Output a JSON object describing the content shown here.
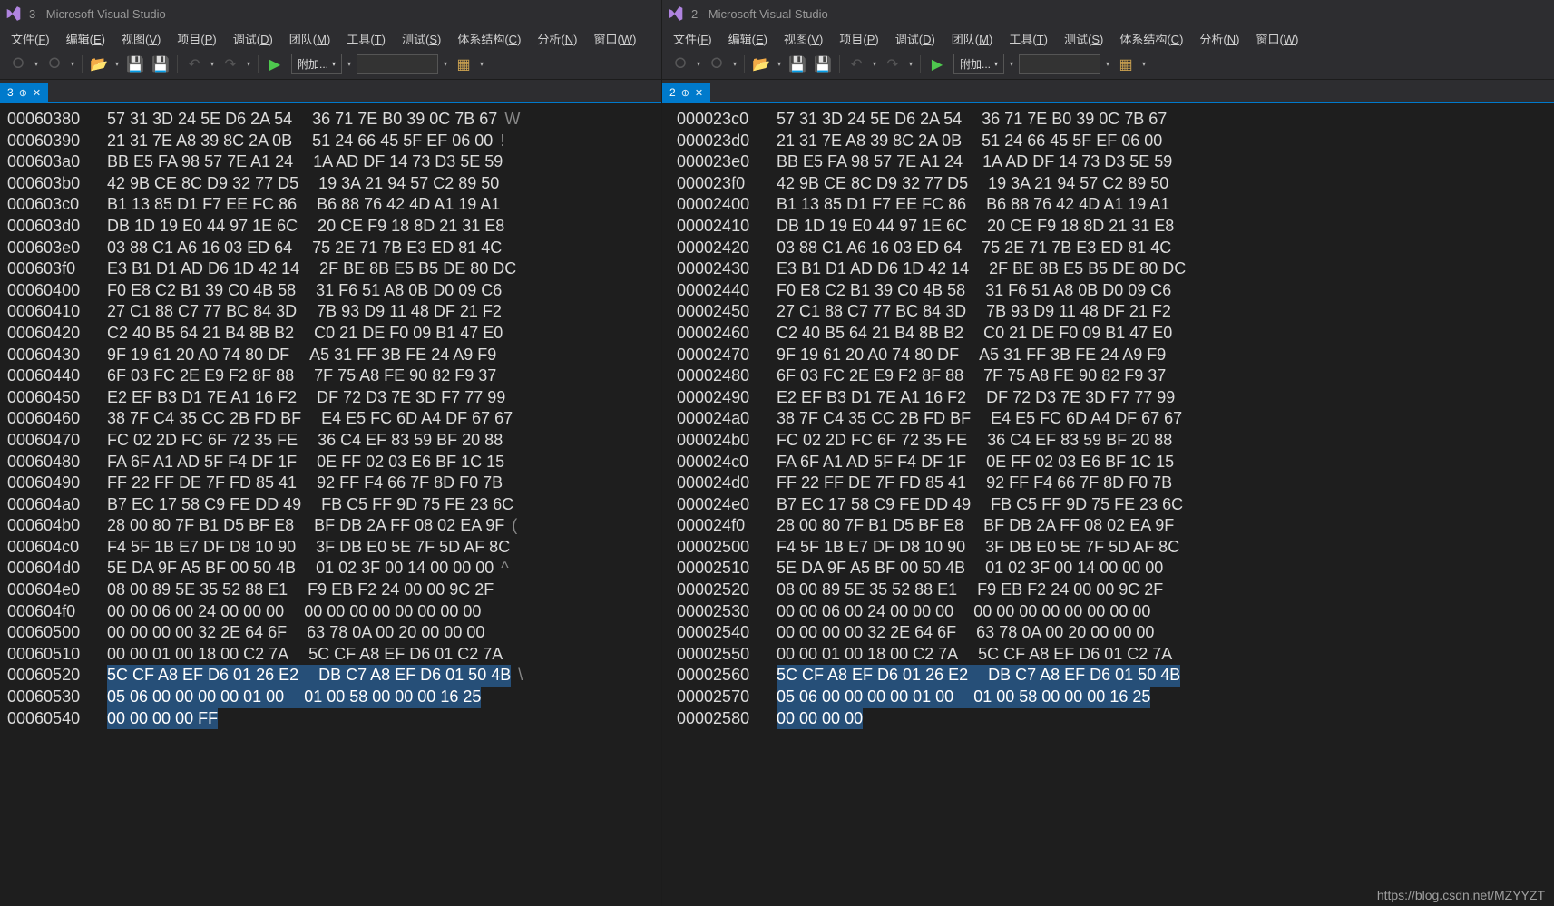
{
  "left": {
    "title": "3 - Microsoft Visual Studio",
    "menu": [
      "文件(F)",
      "编辑(E)",
      "视图(V)",
      "项目(P)",
      "调试(D)",
      "团队(M)",
      "工具(T)",
      "测试(S)",
      "体系结构(C)",
      "分析(N)",
      "窗口(W)"
    ],
    "attach": "附加...",
    "tab": "3",
    "rows": [
      {
        "o": "00060380",
        "a": "57 31 3D 24 5E D6 2A 54",
        "b": "36 71 7E B0 39 0C 7B 67",
        "c": "W"
      },
      {
        "o": "00060390",
        "a": "21 31 7E A8 39 8C 2A 0B",
        "b": "51 24 66 45 5F EF 06 00",
        "c": "!"
      },
      {
        "o": "000603a0",
        "a": "BB E5 FA 98 57 7E A1 24",
        "b": "1A AD DF 14 73 D3 5E 59",
        "c": ""
      },
      {
        "o": "000603b0",
        "a": "42 9B CE 8C D9 32 77 D5",
        "b": "19 3A 21 94 57 C2 89 50",
        "c": ""
      },
      {
        "o": "000603c0",
        "a": "B1 13 85 D1 F7 EE FC 86",
        "b": "B6 88 76 42 4D A1 19 A1",
        "c": ""
      },
      {
        "o": "000603d0",
        "a": "DB 1D 19 E0 44 97 1E 6C",
        "b": "20 CE F9 18 8D 21 31 E8",
        "c": ""
      },
      {
        "o": "000603e0",
        "a": "03 88 C1 A6 16 03 ED 64",
        "b": "75 2E 71 7B E3 ED 81 4C",
        "c": ""
      },
      {
        "o": "000603f0",
        "a": "E3 B1 D1 AD D6 1D 42 14",
        "b": "2F BE 8B E5 B5 DE 80 DC",
        "c": ""
      },
      {
        "o": "00060400",
        "a": "F0 E8 C2 B1 39 C0 4B 58",
        "b": "31 F6 51 A8 0B D0 09 C6",
        "c": ""
      },
      {
        "o": "00060410",
        "a": "27 C1 88 C7 77 BC 84 3D",
        "b": "7B 93 D9 11 48 DF 21 F2",
        "c": ""
      },
      {
        "o": "00060420",
        "a": "C2 40 B5 64 21 B4 8B B2",
        "b": "C0 21 DE F0 09 B1 47 E0",
        "c": ""
      },
      {
        "o": "00060430",
        "a": "9F 19 61 20 A0 74 80 DF",
        "b": "A5 31 FF 3B FE 24 A9 F9",
        "c": ""
      },
      {
        "o": "00060440",
        "a": "6F 03 FC 2E E9 F2 8F 88",
        "b": "7F 75 A8 FE 90 82 F9 37",
        "c": ""
      },
      {
        "o": "00060450",
        "a": "E2 EF B3 D1 7E A1 16 F2",
        "b": "DF 72 D3 7E 3D F7 77 99",
        "c": ""
      },
      {
        "o": "00060460",
        "a": "38 7F C4 35 CC 2B FD BF",
        "b": "E4 E5 FC 6D A4 DF 67 67",
        "c": ""
      },
      {
        "o": "00060470",
        "a": "FC 02 2D FC 6F 72 35 FE",
        "b": "36 C4 EF 83 59 BF 20 88",
        "c": ""
      },
      {
        "o": "00060480",
        "a": "FA 6F A1 AD 5F F4 DF 1F",
        "b": "0E FF 02 03 E6 BF 1C 15",
        "c": ""
      },
      {
        "o": "00060490",
        "a": "FF 22 FF DE 7F FD 85 41",
        "b": "92 FF F4 66 7F 8D F0 7B",
        "c": ""
      },
      {
        "o": "000604a0",
        "a": "B7 EC 17 58 C9 FE DD 49",
        "b": "FB C5 FF 9D 75 FE 23 6C",
        "c": ""
      },
      {
        "o": "000604b0",
        "a": "28 00 80 7F B1 D5 BF E8",
        "b": "BF DB 2A FF 08 02 EA 9F",
        "c": "("
      },
      {
        "o": "000604c0",
        "a": "F4 5F 1B E7 DF D8 10 90",
        "b": "3F DB E0 5E 7F 5D AF 8C",
        "c": ""
      },
      {
        "o": "000604d0",
        "a": "5E DA 9F A5 BF 00 50 4B",
        "b": "01 02 3F 00 14 00 00 00",
        "c": "^"
      },
      {
        "o": "000604e0",
        "a": "08 00 89 5E 35 52 88 E1",
        "b": "F9 EB F2 24 00 00 9C 2F",
        "c": ""
      },
      {
        "o": "000604f0",
        "a": "00 00 06 00 24 00 00 00",
        "b": "00 00 00 00 00 00 00 00",
        "c": ""
      },
      {
        "o": "00060500",
        "a": "00 00 00 00 32 2E 64 6F",
        "b": "63 78 0A 00 20 00 00 00",
        "c": ""
      },
      {
        "o": "00060510",
        "a": "00 00 01 00 18 00 C2 7A",
        "b": "5C CF A8 EF D6 01 C2 7A",
        "c": ""
      }
    ],
    "selected": [
      {
        "o": "00060520",
        "a": "5C CF A8 EF D6 01 26 E2",
        "b": "DB C7 A8 EF D6 01 50 4B",
        "c": "\\"
      },
      {
        "o": "00060530",
        "a": "05 06 00 00 00 00 01 00",
        "b": "01 00 58 00 00 00 16 25",
        "c": ""
      },
      {
        "o": "00060540",
        "a": "00 00 00 00 FF",
        "b": "",
        "c": ""
      }
    ]
  },
  "right": {
    "title": "2 - Microsoft Visual Studio",
    "menu": [
      "文件(F)",
      "编辑(E)",
      "视图(V)",
      "项目(P)",
      "调试(D)",
      "团队(M)",
      "工具(T)",
      "测试(S)",
      "体系结构(C)",
      "分析(N)",
      "窗口(W)"
    ],
    "attach": "附加...",
    "tab": "2",
    "rows": [
      {
        "o": "000023c0",
        "a": "57 31 3D 24 5E D6 2A 54",
        "b": "36 71 7E B0 39 0C 7B 67"
      },
      {
        "o": "000023d0",
        "a": "21 31 7E A8 39 8C 2A 0B",
        "b": "51 24 66 45 5F EF 06 00"
      },
      {
        "o": "000023e0",
        "a": "BB E5 FA 98 57 7E A1 24",
        "b": "1A AD DF 14 73 D3 5E 59"
      },
      {
        "o": "000023f0",
        "a": "42 9B CE 8C D9 32 77 D5",
        "b": "19 3A 21 94 57 C2 89 50"
      },
      {
        "o": "00002400",
        "a": "B1 13 85 D1 F7 EE FC 86",
        "b": "B6 88 76 42 4D A1 19 A1"
      },
      {
        "o": "00002410",
        "a": "DB 1D 19 E0 44 97 1E 6C",
        "b": "20 CE F9 18 8D 21 31 E8"
      },
      {
        "o": "00002420",
        "a": "03 88 C1 A6 16 03 ED 64",
        "b": "75 2E 71 7B E3 ED 81 4C"
      },
      {
        "o": "00002430",
        "a": "E3 B1 D1 AD D6 1D 42 14",
        "b": "2F BE 8B E5 B5 DE 80 DC"
      },
      {
        "o": "00002440",
        "a": "F0 E8 C2 B1 39 C0 4B 58",
        "b": "31 F6 51 A8 0B D0 09 C6"
      },
      {
        "o": "00002450",
        "a": "27 C1 88 C7 77 BC 84 3D",
        "b": "7B 93 D9 11 48 DF 21 F2"
      },
      {
        "o": "00002460",
        "a": "C2 40 B5 64 21 B4 8B B2",
        "b": "C0 21 DE F0 09 B1 47 E0"
      },
      {
        "o": "00002470",
        "a": "9F 19 61 20 A0 74 80 DF",
        "b": "A5 31 FF 3B FE 24 A9 F9"
      },
      {
        "o": "00002480",
        "a": "6F 03 FC 2E E9 F2 8F 88",
        "b": "7F 75 A8 FE 90 82 F9 37"
      },
      {
        "o": "00002490",
        "a": "E2 EF B3 D1 7E A1 16 F2",
        "b": "DF 72 D3 7E 3D F7 77 99"
      },
      {
        "o": "000024a0",
        "a": "38 7F C4 35 CC 2B FD BF",
        "b": "E4 E5 FC 6D A4 DF 67 67"
      },
      {
        "o": "000024b0",
        "a": "FC 02 2D FC 6F 72 35 FE",
        "b": "36 C4 EF 83 59 BF 20 88"
      },
      {
        "o": "000024c0",
        "a": "FA 6F A1 AD 5F F4 DF 1F",
        "b": "0E FF 02 03 E6 BF 1C 15"
      },
      {
        "o": "000024d0",
        "a": "FF 22 FF DE 7F FD 85 41",
        "b": "92 FF F4 66 7F 8D F0 7B"
      },
      {
        "o": "000024e0",
        "a": "B7 EC 17 58 C9 FE DD 49",
        "b": "FB C5 FF 9D 75 FE 23 6C"
      },
      {
        "o": "000024f0",
        "a": "28 00 80 7F B1 D5 BF E8",
        "b": "BF DB 2A FF 08 02 EA 9F"
      },
      {
        "o": "00002500",
        "a": "F4 5F 1B E7 DF D8 10 90",
        "b": "3F DB E0 5E 7F 5D AF 8C"
      },
      {
        "o": "00002510",
        "a": "5E DA 9F A5 BF 00 50 4B",
        "b": "01 02 3F 00 14 00 00 00"
      },
      {
        "o": "00002520",
        "a": "08 00 89 5E 35 52 88 E1",
        "b": "F9 EB F2 24 00 00 9C 2F"
      },
      {
        "o": "00002530",
        "a": "00 00 06 00 24 00 00 00",
        "b": "00 00 00 00 00 00 00 00"
      },
      {
        "o": "00002540",
        "a": "00 00 00 00 32 2E 64 6F",
        "b": "63 78 0A 00 20 00 00 00"
      },
      {
        "o": "00002550",
        "a": "00 00 01 00 18 00 C2 7A",
        "b": "5C CF A8 EF D6 01 C2 7A"
      }
    ],
    "selected": [
      {
        "o": "00002560",
        "a": "5C CF A8 EF D6 01 26 E2",
        "b": "DB C7 A8 EF D6 01 50 4B"
      },
      {
        "o": "00002570",
        "a": "05 06 00 00 00 00 01 00",
        "b": "01 00 58 00 00 00 16 25"
      },
      {
        "o": "00002580",
        "a": "00 00 00 00",
        "b": ""
      }
    ]
  },
  "watermark": "https://blog.csdn.net/MZYYZT"
}
